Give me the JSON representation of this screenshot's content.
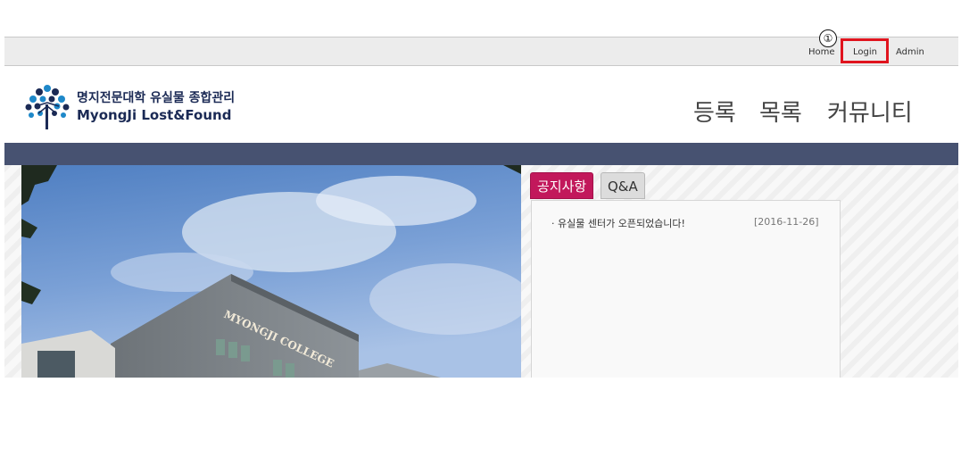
{
  "topbar": {
    "links": [
      "Home",
      "Login",
      "Admin"
    ],
    "step_marker": "①"
  },
  "header": {
    "logo_title_kr": "명지전문대학 유실물 종합관리",
    "logo_title_en": "MyongJi Lost&Found",
    "nav": [
      "등록",
      "목록",
      "커뮤니티"
    ]
  },
  "hero": {
    "photo_sign": "MYONGJI COLLEGE"
  },
  "notice_panel": {
    "tabs": [
      "공지사항",
      "Q&A"
    ],
    "items": [
      {
        "title": "· 유실물 센터가 오픈되었습니다!",
        "date": "[2016-11-26]"
      }
    ]
  },
  "colors": {
    "band": "#475271",
    "notice_tab": "#c2185b",
    "highlight": "#e0141e",
    "logo": "#1b2a55"
  }
}
